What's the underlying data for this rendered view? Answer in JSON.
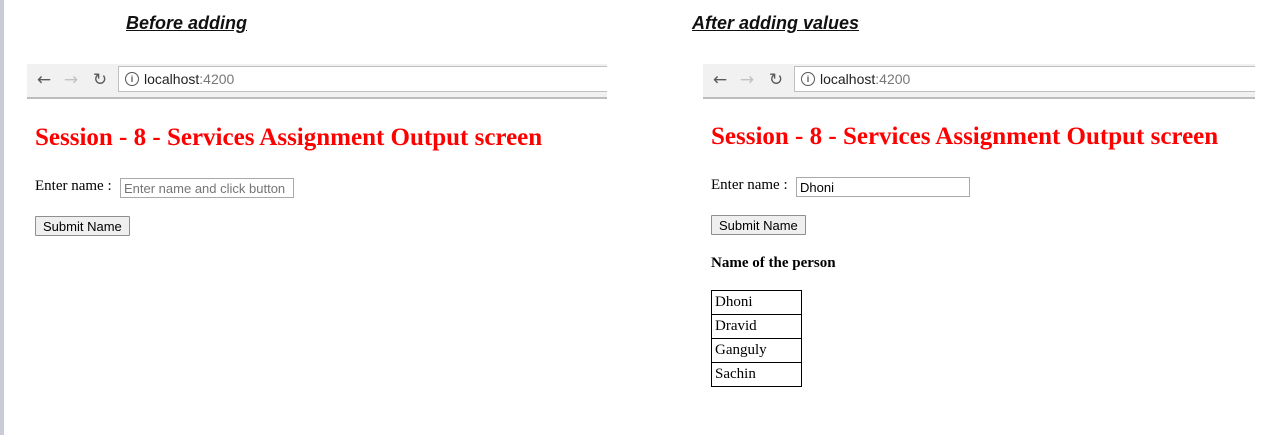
{
  "left": {
    "caption": "Before adding",
    "browser": {
      "url_host": "localhost",
      "url_port": ":4200"
    },
    "page": {
      "title": "Session - 8 - Services Assignment Output screen",
      "label": "Enter name :",
      "input_value": "",
      "input_placeholder": "Enter name and click button",
      "button_label": "Submit Name"
    }
  },
  "right": {
    "caption": "After adding values",
    "browser": {
      "url_host": "localhost",
      "url_port": ":4200"
    },
    "page": {
      "title": "Session - 8 - Services Assignment Output screen",
      "label": "Enter name :",
      "input_value": "Dhoni",
      "button_label": "Submit Name",
      "list_heading": "Name of the person",
      "names": [
        "Dhoni",
        "Dravid",
        "Ganguly",
        "Sachin"
      ]
    }
  },
  "icons": {
    "back": "arrow-left-icon",
    "forward": "arrow-right-icon",
    "reload": "reload-icon",
    "info": "info-icon"
  },
  "colors": {
    "title": "#ff0000",
    "toolbar": "#f1f1f1"
  }
}
